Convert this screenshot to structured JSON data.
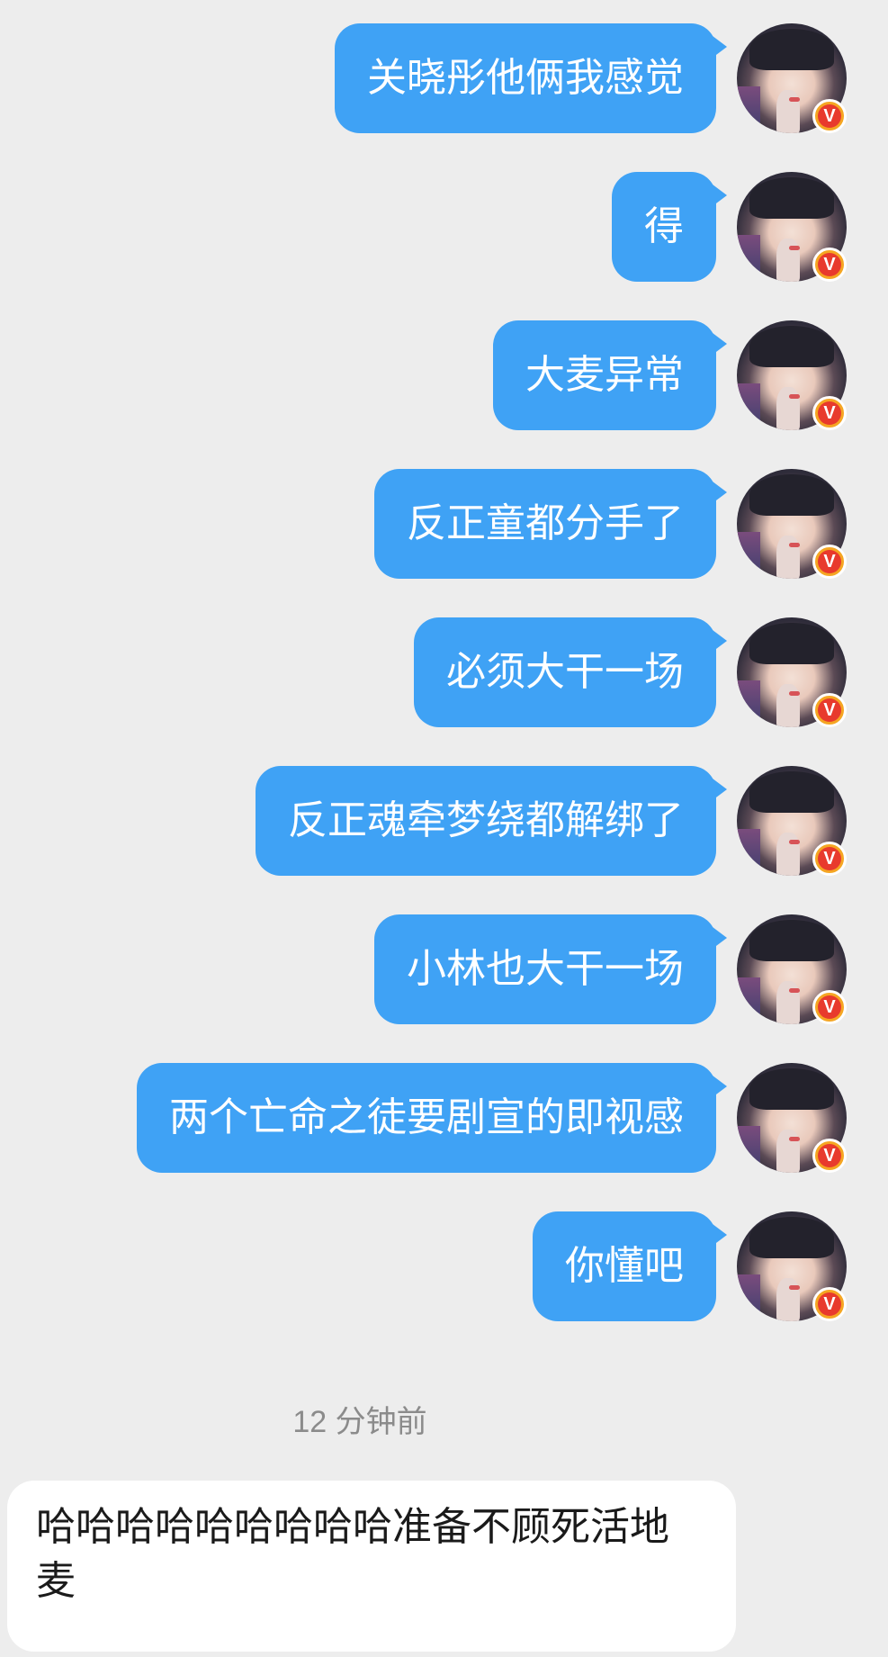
{
  "messages_outgoing": [
    {
      "text": "关晓彤他俩我感觉"
    },
    {
      "text": "得"
    },
    {
      "text": "大麦异常"
    },
    {
      "text": "反正童都分手了"
    },
    {
      "text": "必须大干一场"
    },
    {
      "text": "反正魂牵梦绕都解绑了"
    },
    {
      "text": "小林也大干一场"
    },
    {
      "text": "两个亡命之徒要剧宣的即视感"
    },
    {
      "text": "你懂吧"
    }
  ],
  "timestamp": "12 分钟前",
  "message_incoming": {
    "text": "哈哈哈哈哈哈哈哈哈准备不顾死活地麦"
  },
  "avatar": {
    "badge_letter": "V",
    "icon": "verified-badge-icon"
  },
  "colors": {
    "background": "#ededed",
    "outgoing_bubble": "#3fa2f5",
    "incoming_bubble": "#ffffff",
    "badge_orange": "#f5a623",
    "badge_red": "#e83a2d",
    "timestamp": "#8b8b8b"
  }
}
